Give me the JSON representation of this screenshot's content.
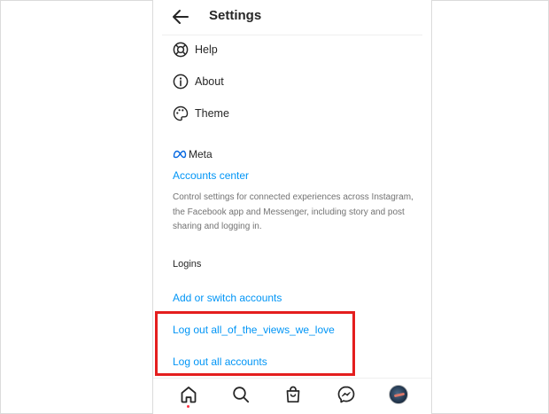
{
  "header": {
    "title": "Settings"
  },
  "menu": [
    {
      "label": "Help",
      "icon": "lifebuoy-icon"
    },
    {
      "label": "About",
      "icon": "info-icon"
    },
    {
      "label": "Theme",
      "icon": "palette-icon"
    }
  ],
  "meta": {
    "brand": "Meta",
    "accounts_center": "Accounts center",
    "description": "Control settings for connected experiences across Instagram, the Facebook app and Messenger, including story and post sharing and logging in."
  },
  "logins": {
    "title": "Logins",
    "add_switch": "Add or switch accounts",
    "logout_user": "Log out all_of_the_views_we_love",
    "logout_all": "Log out all accounts"
  },
  "nav": [
    "home-icon",
    "search-icon",
    "shop-icon",
    "messenger-icon",
    "profile-avatar"
  ],
  "colors": {
    "link": "#0095f6",
    "highlight": "#e41e1e",
    "text": "#262626",
    "muted": "#737373"
  }
}
